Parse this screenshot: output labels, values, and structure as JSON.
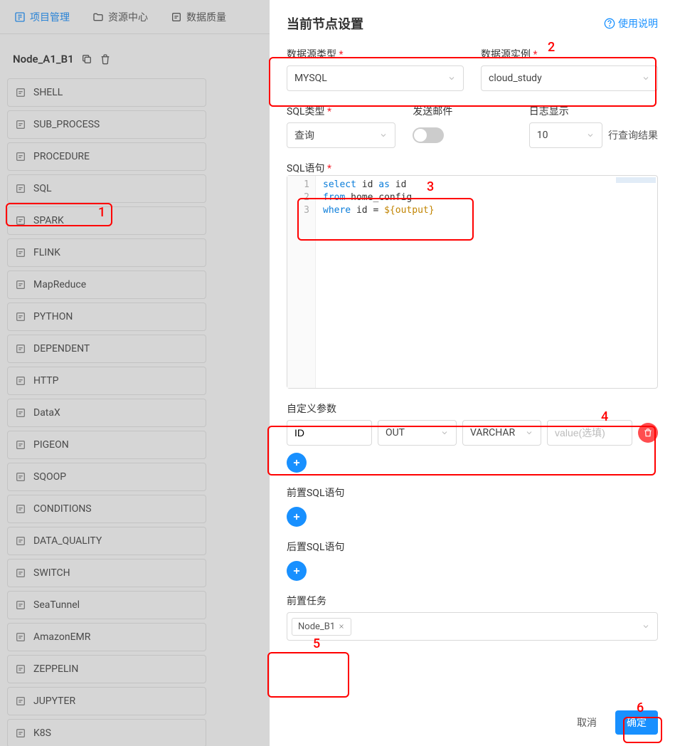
{
  "nav": {
    "items": [
      {
        "label": "项目管理",
        "active": true
      },
      {
        "label": "资源中心",
        "active": false
      },
      {
        "label": "数据质量",
        "active": false
      }
    ]
  },
  "node": {
    "name": "Node_A1_B1"
  },
  "taskTypes": [
    "SHELL",
    "SUB_PROCESS",
    "PROCEDURE",
    "SQL",
    "SPARK",
    "FLINK",
    "MapReduce",
    "PYTHON",
    "DEPENDENT",
    "HTTP",
    "DataX",
    "PIGEON",
    "SQOOP",
    "CONDITIONS",
    "DATA_QUALITY",
    "SWITCH",
    "SeaTunnel",
    "AmazonEMR",
    "ZEPPELIN",
    "JUPYTER",
    "K8S"
  ],
  "drawer": {
    "title": "当前节点设置",
    "helpText": "使用说明"
  },
  "form": {
    "dsType": {
      "label": "数据源类型",
      "value": "MYSQL"
    },
    "dsInstance": {
      "label": "数据源实例",
      "value": "cloud_study"
    },
    "sqlType": {
      "label": "SQL类型",
      "value": "查询"
    },
    "sendMail": {
      "label": "发送邮件",
      "on": false
    },
    "logDisplay": {
      "label": "日志显示",
      "value": "10",
      "suffix": "行查询结果"
    },
    "sqlStmt": {
      "label": "SQL语句",
      "lines": [
        {
          "n": 1,
          "tokens": [
            [
              "kw",
              "select"
            ],
            [
              "sp",
              " "
            ],
            [
              "ident",
              "id"
            ],
            [
              "sp",
              " "
            ],
            [
              "kw",
              "as"
            ],
            [
              "sp",
              " "
            ],
            [
              "ident",
              "id"
            ]
          ]
        },
        {
          "n": 2,
          "tokens": [
            [
              "kw",
              "from"
            ],
            [
              "sp",
              " "
            ],
            [
              "ident",
              "home_config"
            ]
          ]
        },
        {
          "n": 3,
          "tokens": [
            [
              "kw",
              "where"
            ],
            [
              "sp",
              " "
            ],
            [
              "ident",
              "id"
            ],
            [
              "sp",
              " "
            ],
            [
              "ident",
              "="
            ],
            [
              "sp",
              " "
            ],
            [
              "param",
              "${output}"
            ]
          ]
        }
      ]
    },
    "customParams": {
      "label": "自定义参数",
      "rows": [
        {
          "name": "ID",
          "direction": "OUT",
          "type": "VARCHAR",
          "valuePlaceholder": "value(选填)"
        }
      ]
    },
    "preSql": {
      "label": "前置SQL语句"
    },
    "postSql": {
      "label": "后置SQL语句"
    },
    "preTask": {
      "label": "前置任务",
      "tags": [
        "Node_B1"
      ]
    }
  },
  "footer": {
    "cancel": "取消",
    "ok": "确定"
  },
  "callouts": {
    "c1": "1",
    "c2": "2",
    "c3": "3",
    "c4": "4",
    "c5": "5",
    "c6": "6"
  }
}
